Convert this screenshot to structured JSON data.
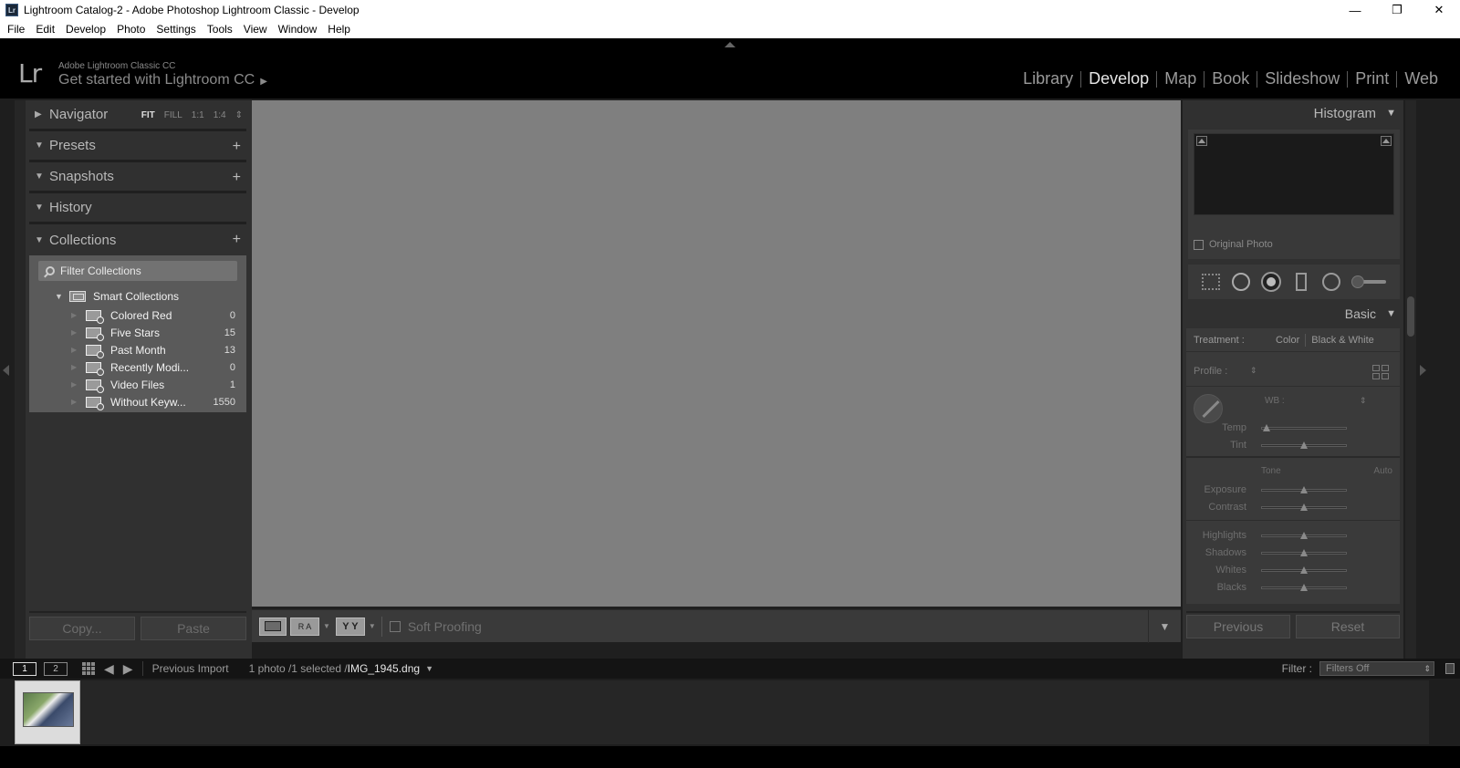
{
  "window": {
    "app_icon": "Lr",
    "title": "Lightroom Catalog-2 - Adobe Photoshop Lightroom Classic - Develop",
    "controls": [
      "—",
      "❐",
      "✕"
    ]
  },
  "menu": [
    "File",
    "Edit",
    "Develop",
    "Photo",
    "Settings",
    "Tools",
    "View",
    "Window",
    "Help"
  ],
  "identity": {
    "logo": "Lr",
    "subtitle": "Adobe Lightroom Classic CC",
    "get_started": "Get started with Lightroom CC",
    "caret": "▶"
  },
  "modules": [
    "Library",
    "Develop",
    "Map",
    "Book",
    "Slideshow",
    "Print",
    "Web"
  ],
  "active_module": "Develop",
  "left_panel": {
    "navigator": {
      "label": "Navigator",
      "options": [
        "FIT",
        "FILL",
        "1:1",
        "1:4"
      ],
      "stepper": "⇕"
    },
    "presets": {
      "label": "Presets",
      "plus": "+"
    },
    "snapshots": {
      "label": "Snapshots",
      "plus": "+"
    },
    "history": {
      "label": "History"
    },
    "collections": {
      "label": "Collections",
      "plus": "+",
      "filter_placeholder": "Filter Collections",
      "smart_collections_label": "Smart Collections",
      "items": [
        {
          "name": "Colored Red",
          "count": "0"
        },
        {
          "name": "Five Stars",
          "count": "15"
        },
        {
          "name": "Past Month",
          "count": "13"
        },
        {
          "name": "Recently Modi...",
          "count": "0"
        },
        {
          "name": "Video Files",
          "count": "1"
        },
        {
          "name": "Without Keyw...",
          "count": "1550"
        }
      ]
    },
    "copy_label": "Copy...",
    "paste_label": "Paste"
  },
  "toolbar": {
    "ra_label": "R A",
    "yy_label": "Y Y",
    "soft_proofing": "Soft Proofing"
  },
  "right_panel": {
    "histogram_label": "Histogram",
    "original_photo": "Original Photo",
    "basic_label": "Basic",
    "treatment_label": "Treatment :",
    "treatment_color": "Color",
    "treatment_bw": "Black & White",
    "profile_label": "Profile :",
    "wb_label": "WB :",
    "temp": {
      "label": "Temp",
      "value": 0.06
    },
    "tint": {
      "label": "Tint",
      "value": 0.5
    },
    "tone_label": "Tone",
    "auto_label": "Auto",
    "exposure": {
      "label": "Exposure",
      "value": 0.5
    },
    "contrast": {
      "label": "Contrast",
      "value": 0.5
    },
    "highlights": {
      "label": "Highlights",
      "value": 0.5
    },
    "shadows": {
      "label": "Shadows",
      "value": 0.5
    },
    "whites": {
      "label": "Whites",
      "value": 0.5
    },
    "blacks": {
      "label": "Blacks",
      "value": 0.5
    },
    "previous_label": "Previous",
    "reset_label": "Reset"
  },
  "filmstrip": {
    "monitor1": "1",
    "monitor2": "2",
    "source": "Previous Import",
    "selection_prefix": "1 photo /1 selected /",
    "filename": "IMG_1945.dng",
    "filter_label": "Filter :",
    "filter_value": "Filters Off"
  },
  "colors": {
    "background": "#1e1e1e",
    "panel": "#303030",
    "canvas": "#7f7f7f",
    "collections_bg": "#5a5a5a"
  }
}
